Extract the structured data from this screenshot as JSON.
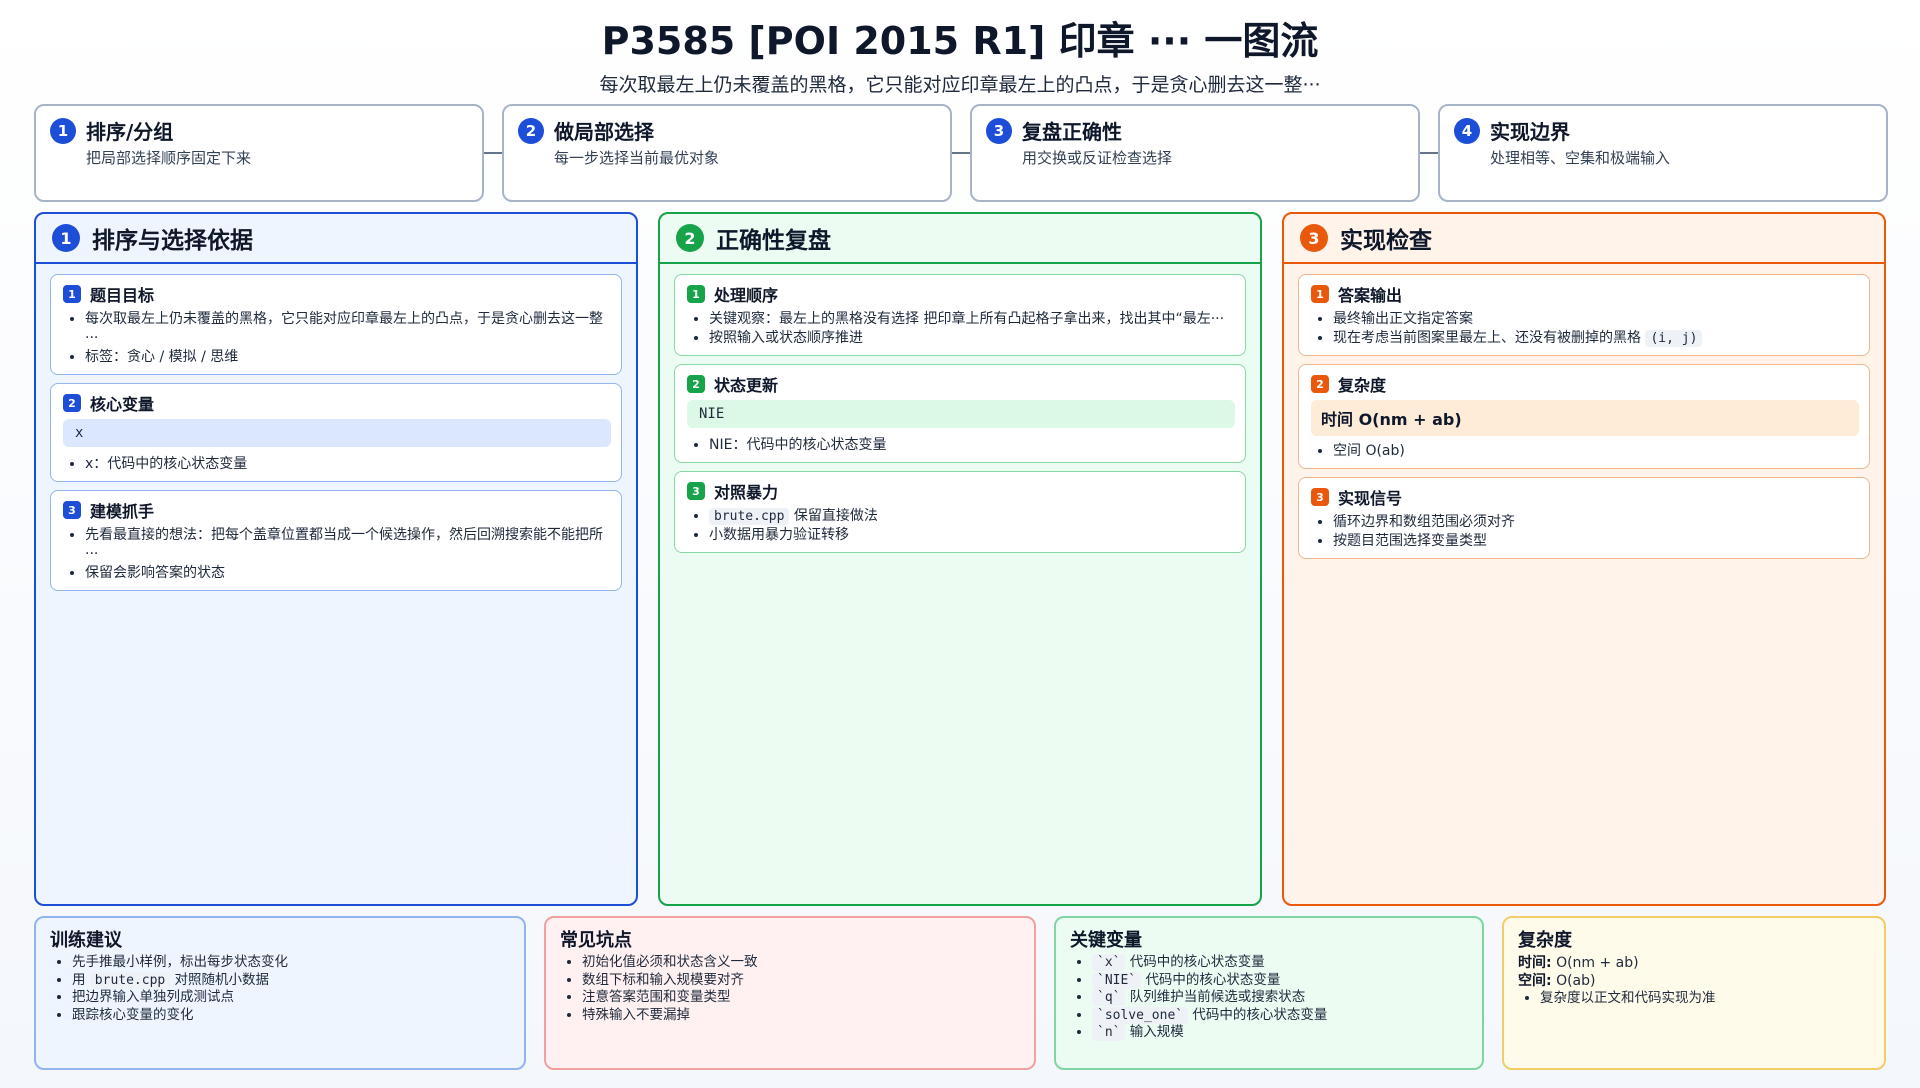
{
  "header": {
    "title": "P3585 [POI 2015 R1] 印章 ··· 一图流",
    "subtitle": "每次取最左上仍未覆盖的黑格，它只能对应印章最左上的凸点，于是贪心删去这一整···"
  },
  "steps": [
    {
      "num": "1",
      "title": "排序/分组",
      "desc": "把局部选择顺序固定下来"
    },
    {
      "num": "2",
      "title": "做局部选择",
      "desc": "每一步选择当前最优对象"
    },
    {
      "num": "3",
      "title": "复盘正确性",
      "desc": "用交换或反证检查选择"
    },
    {
      "num": "4",
      "title": "实现边界",
      "desc": "处理相等、空集和极端输入"
    }
  ],
  "panels": {
    "left": {
      "num": "1",
      "title": "排序与选择依据",
      "card1": {
        "num": "1",
        "title": "题目目标",
        "items": [
          "每次取最左上仍未覆盖的黑格，它只能对应印章最左上的凸点，于是贪心删去这一整···",
          "标签：贪心 / 模拟 / 思维"
        ]
      },
      "card2": {
        "num": "2",
        "title": "核心变量",
        "code": "x",
        "items": [
          "x：代码中的核心状态变量"
        ]
      },
      "card3": {
        "num": "3",
        "title": "建模抓手",
        "items": [
          "先看最直接的想法：把每个盖章位置都当成一个候选操作，然后回溯搜索能不能把所···",
          "保留会影响答案的状态"
        ]
      }
    },
    "middle": {
      "num": "2",
      "title": "正确性复盘",
      "card1": {
        "num": "1",
        "title": "处理顺序",
        "items": [
          "关键观察：最左上的黑格没有选择 把印章上所有凸起格子拿出来，找出其中“最左···",
          "按照输入或状态顺序推进"
        ]
      },
      "card2": {
        "num": "2",
        "title": "状态更新",
        "code": "NIE",
        "items": [
          "NIE：代码中的核心状态变量"
        ]
      },
      "card3": {
        "num": "3",
        "title": "对照暴力",
        "code1": "brute.cpp",
        "item1_rest": "保留直接做法",
        "item2": "小数据用暴力验证转移"
      }
    },
    "right": {
      "num": "3",
      "title": "实现检查",
      "card1": {
        "num": "1",
        "title": "答案输出",
        "item1": "最终输出正文指定答案",
        "item2_pre": "现在考虑当前图案里最左上、还没有被删掉的黑格",
        "item2_code": "(i, j)"
      },
      "card2": {
        "num": "2",
        "title": "复杂度",
        "highlight": "时间 O(nm + ab)",
        "items": [
          "空间 O(ab)"
        ]
      },
      "card3": {
        "num": "3",
        "title": "实现信号",
        "items": [
          "循环边界和数组范围必须对齐",
          "按题目范围选择变量类型"
        ]
      }
    }
  },
  "bottom": {
    "training": {
      "title": "训练建议",
      "item1": "先手推最小样例，标出每步状态变化",
      "item2_pre": "用",
      "item2_code": "brute.cpp",
      "item2_post": "对照随机小数据",
      "item3": "把边界输入单独列成测试点",
      "item4": "跟踪核心变量的变化"
    },
    "pitfalls": {
      "title": "常见坑点",
      "items": [
        "初始化值必须和状态含义一致",
        "数组下标和输入规模要对齐",
        "注意答案范围和变量类型",
        "特殊输入不要漏掉"
      ]
    },
    "variables": {
      "title": "关键变量",
      "items": [
        {
          "code": "`x`",
          "text": "代码中的核心状态变量"
        },
        {
          "code": "`NIE`",
          "text": "代码中的核心状态变量"
        },
        {
          "code": "`q`",
          "text": "队列维护当前候选或搜索状态"
        },
        {
          "code": "`solve_one`",
          "text": "代码中的核心状态变量"
        },
        {
          "code": "`n`",
          "text": "输入规模"
        }
      ]
    },
    "complexity": {
      "title": "复杂度",
      "time_label": "时间:",
      "time_value": "O(nm + ab)",
      "space_label": "空间:",
      "space_value": "O(ab)",
      "note": "复杂度以正文和代码实现为准"
    }
  }
}
